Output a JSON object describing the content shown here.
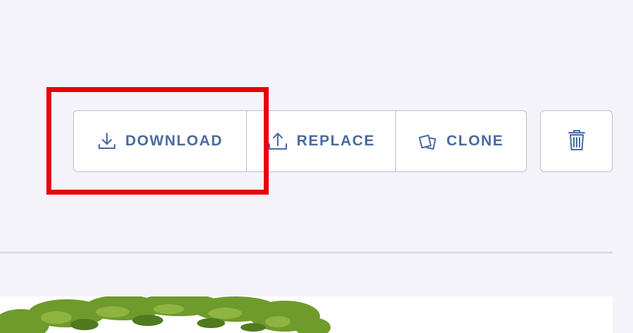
{
  "toolbar": {
    "download_label": "DOWNLOAD",
    "replace_label": "REPLACE",
    "clone_label": "CLONE"
  },
  "icons": {
    "download": "download-icon",
    "replace": "upload-icon",
    "clone": "clone-icon",
    "delete": "trash-icon"
  },
  "colors": {
    "background": "#f3f3f9",
    "button_text": "#4a6a9e",
    "button_border": "#b9c0d4",
    "highlight": "#e8000c",
    "foliage": "#6f9a2c"
  }
}
